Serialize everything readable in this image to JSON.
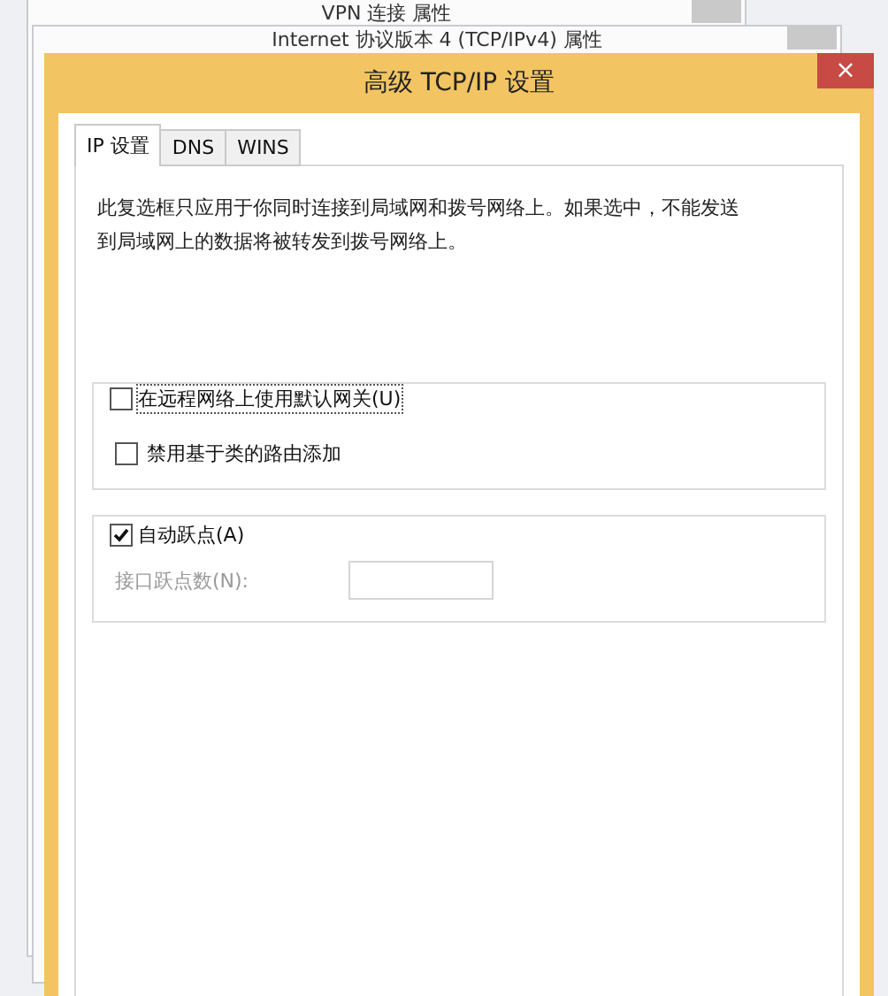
{
  "background_windows": [
    {
      "title": "VPN 连接 属性"
    },
    {
      "title": "Internet 协议版本 4 (TCP/IPv4) 属性"
    }
  ],
  "window": {
    "title": "高级 TCP/IP 设置",
    "close": "×"
  },
  "tabs": [
    {
      "label": "IP 设置",
      "selected": true
    },
    {
      "label": "DNS",
      "selected": false
    },
    {
      "label": "WINS",
      "selected": false
    }
  ],
  "description": "此复选框只应用于你同时连接到局域网和拨号网络上。如果选中，不能发送到局域网上的数据将被转发到拨号网络上。",
  "gateway_group": {
    "label": "在远程网络上使用默认网关(U)",
    "checked": false,
    "option": {
      "label": "禁用基于类的路由添加",
      "checked": false
    }
  },
  "metric_group": {
    "label": "自动跃点(A)",
    "checked": true,
    "field": {
      "label": "接口跃点数(N):",
      "disabled": true
    }
  }
}
